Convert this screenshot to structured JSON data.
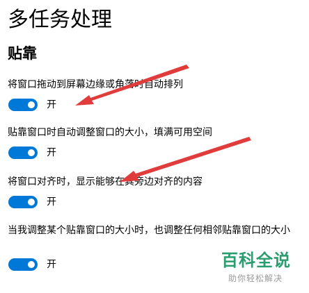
{
  "page": {
    "title": "多任务处理"
  },
  "section": {
    "title": "贴靠"
  },
  "settings": [
    {
      "label": "将窗口拖动到屏幕边缘或角落时自动排列",
      "state": "开"
    },
    {
      "label": "贴靠窗口时自动调整窗口的大小，填满可用空间",
      "state": "开"
    },
    {
      "label": "将窗口对齐时，显示能够在其旁边对齐的内容",
      "state": "开"
    },
    {
      "label": "当我调整某个贴靠窗口的大小时，也调整任何相邻贴靠窗口的大小",
      "state": "开"
    }
  ],
  "watermark": {
    "logo": "百科全说",
    "subtitle": "助你轻松解决"
  },
  "colors": {
    "toggle_on": "#0078d7",
    "arrow": "#e03c3c",
    "brand": "#2a9d6f"
  }
}
